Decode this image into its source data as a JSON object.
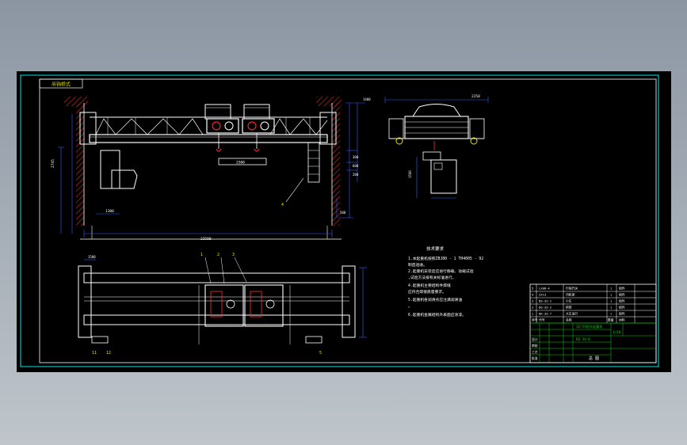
{
  "colors": {
    "background": "#9aa3ad",
    "sheet": "#000000",
    "frame_outer": "#00e5e5",
    "frame_inner": "#ffffff",
    "structure": "#ffffff",
    "dimension": "#3a5cff",
    "hatch": "#c0281e",
    "label": "#e8e800",
    "title_block": "#10d010",
    "accent": "#ff3030"
  },
  "drawing_id_box": "吊钩桥式",
  "notes": {
    "heading": "技术要求",
    "lines": [
      "1.本起重机按照ZBJ80 - 1 TH4005 - 92",
      "  制造验收。",
      "2.起重机安装后应进行静载、动载试验",
      "  ,试验方法按有关标准进行。",
      "4.起重机主要结构件焊缝",
      "  应符合焊接质量要求。",
      "5.起重机各润滑点应注满润滑油",
      "  。",
      "6.起重机金属结构外表面应涂漆。"
    ]
  },
  "dimensions": {
    "span_main": "22500",
    "trolley_gauge": "2500",
    "side_view_top": "2250",
    "left_height": "2745",
    "side_height": "1500",
    "right_stack": [
      "300",
      "600",
      "200",
      "1400"
    ],
    "bottom_right": "500",
    "mid_small": "1300",
    "plan_top": "1500"
  },
  "part_labels": {
    "elevation_leader": "4",
    "plan_leaders": [
      "1",
      "2",
      "3"
    ],
    "plan_bottom": [
      "11",
      "12",
      "5"
    ]
  },
  "parts_list": [
    {
      "no": "5",
      "code": "LX08-4",
      "name": "行程开关",
      "qty": "1",
      "mat": "组件"
    },
    {
      "no": "4",
      "code": "ZZ13",
      "name": "司机室",
      "qty": "1",
      "mat": "组件"
    },
    {
      "no": "3",
      "code": "DQ-33-1",
      "name": "小车",
      "qty": "1",
      "mat": "组件"
    },
    {
      "no": "2",
      "code": "DQ-33-2",
      "name": "桥架",
      "qty": "1",
      "mat": "组件"
    },
    {
      "no": "1",
      "code": "DR-33-7",
      "name": "大车运行",
      "qty": "1",
      "mat": "组件"
    }
  ],
  "title_block": {
    "header": [
      "序号",
      "代号",
      "名称",
      "数量",
      "材料"
    ],
    "drawing_name": "32/5t桥式起重机",
    "drawing_code": "DQ-33-0",
    "scale": "1:50",
    "sheet_label": "总 图",
    "roles": [
      "设计",
      "审核",
      "工艺",
      "批准"
    ]
  }
}
